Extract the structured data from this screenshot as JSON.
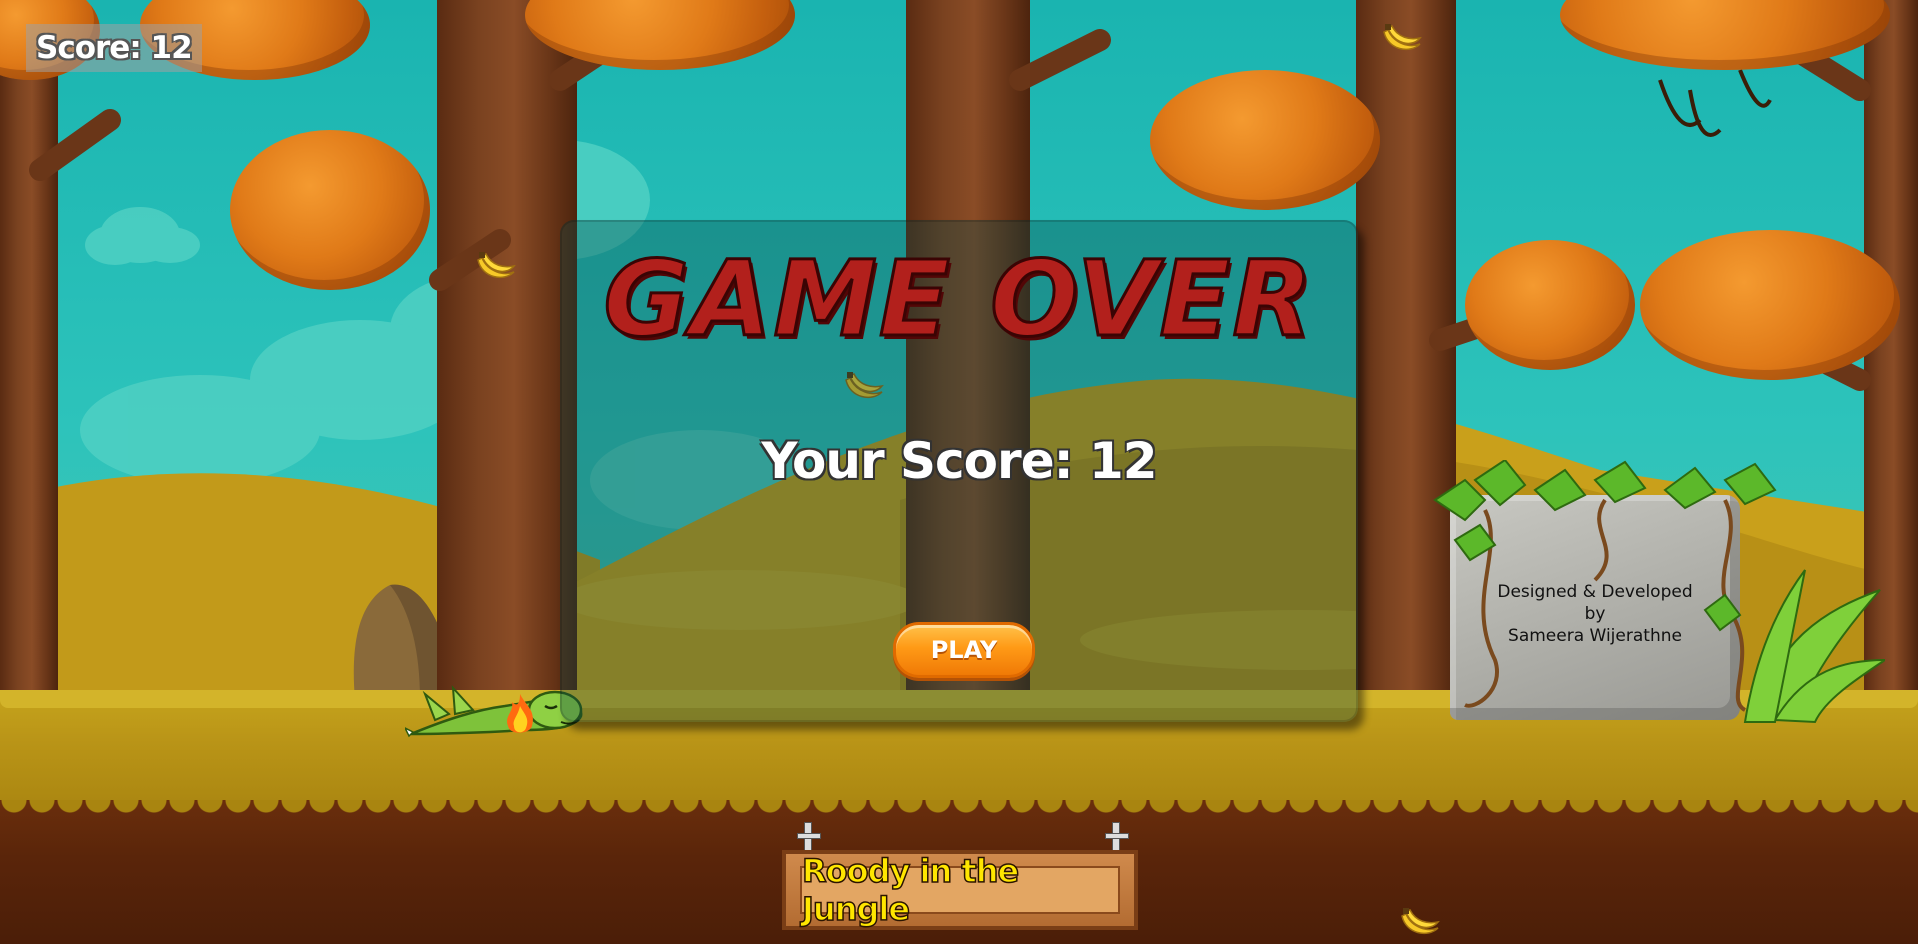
{
  "hud": {
    "score_label": "Score: 12"
  },
  "game_over": {
    "title": "GAME OVER",
    "your_score": "Your Score: 12",
    "play_label": "PLAY"
  },
  "credits": {
    "line1": "Designed & Developed",
    "line2": "by",
    "line3": "Sameera Wijerathne"
  },
  "sign": {
    "game_title": "Roody in the Jungle"
  },
  "colors": {
    "sky": "#1ab4b0",
    "foliage": "#e07a18",
    "ground": "#c5a31c",
    "dirt": "#5a250a",
    "game_over_red": "#b2201c",
    "play_orange": "#ff9a16",
    "title_yellow": "#ffe600"
  },
  "icons": [
    "banana-icon",
    "dino-character-icon",
    "fire-icon",
    "vine-leaves-icon"
  ]
}
